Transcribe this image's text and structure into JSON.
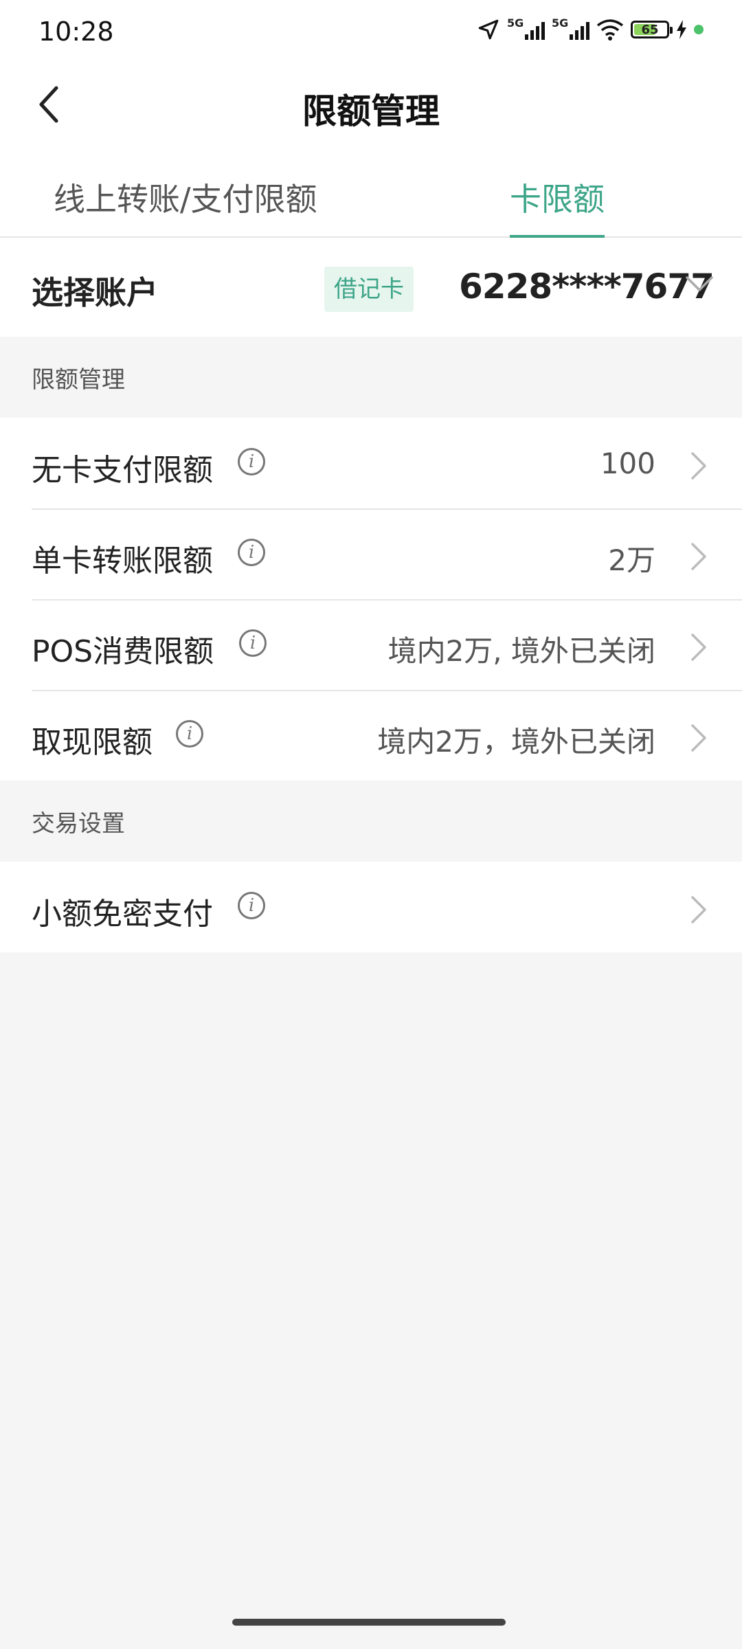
{
  "status_bar": {
    "time": "10:28",
    "network1": "5G",
    "network2": "5G",
    "battery": "65"
  },
  "nav": {
    "title": "限额管理"
  },
  "tabs": [
    {
      "label": "线上转账/支付限额"
    },
    {
      "label": "卡限额",
      "active": true
    }
  ],
  "account": {
    "label": "选择账户",
    "card_type": "借记卡",
    "card_number": "6228****7677"
  },
  "sections": [
    {
      "title": "限额管理",
      "rows": [
        {
          "label": "无卡支付限额",
          "value": "100"
        },
        {
          "label": "单卡转账限额",
          "value": "2万"
        },
        {
          "label": "POS消费限额",
          "value": "境内2万, 境外已关闭"
        },
        {
          "label": "取现限额",
          "value": "境内2万，境外已关闭"
        }
      ]
    },
    {
      "title": "交易设置",
      "rows": [
        {
          "label": "小额免密支付",
          "value": ""
        }
      ]
    }
  ],
  "colors": {
    "accent": "#3da588",
    "background": "#f5f5f5"
  }
}
